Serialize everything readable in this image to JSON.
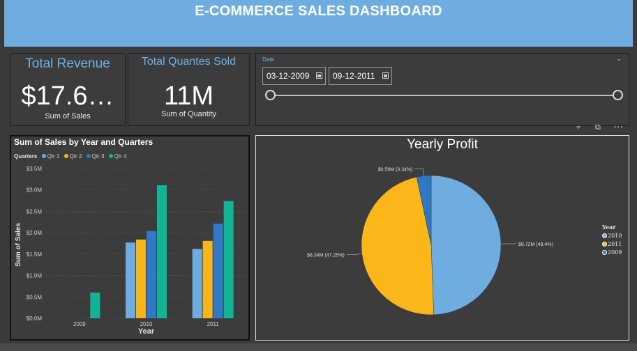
{
  "header": {
    "title": "E-COMMERCE SALES DASHBOARD"
  },
  "kpi_revenue": {
    "title": "Total Revenue",
    "value": "$17.6…",
    "subtitle": "Sum of Sales"
  },
  "kpi_quantity": {
    "title": "Total Quantes Sold",
    "value": "11M",
    "subtitle": "Sum of Quantity"
  },
  "date_slicer": {
    "title": "Date",
    "start": "03-12-2009",
    "end": "09-12-2011",
    "range_start_fraction": 0,
    "range_end_fraction": 1
  },
  "visual_header_icons": [
    "filter-icon",
    "focus-mode-icon",
    "more-options-icon"
  ],
  "colors": {
    "qtr1": "#6fade0",
    "qtr2": "#f5b51b",
    "qtr3": "#2f79c8",
    "qtr4": "#12b496",
    "y2010": "#6fade0",
    "y2011": "#fbb61a",
    "y2009": "#2e77c4",
    "header": "#6fade0"
  },
  "chart_data": [
    {
      "type": "bar",
      "title": "Sum of Sales by Year and Quarters",
      "legend_title": "Quarters",
      "legend_position": "top-left",
      "categories": [
        "2009",
        "2010",
        "2011"
      ],
      "series": [
        {
          "name": "Qtr 1",
          "values": [
            0,
            1.77,
            1.62
          ]
        },
        {
          "name": "Qtr 2",
          "values": [
            0,
            1.84,
            1.81
          ]
        },
        {
          "name": "Qtr 3",
          "values": [
            0,
            2.04,
            2.21
          ]
        },
        {
          "name": "Qtr 4",
          "values": [
            0.6,
            3.11,
            2.74
          ]
        }
      ],
      "xlabel": "Year",
      "ylabel": "Sum of Sales",
      "ylim": [
        0,
        3.5
      ],
      "yticks": [
        "$0.0M",
        "$0.5M",
        "$1.0M",
        "$1.5M",
        "$2.0M",
        "$2.5M",
        "$3.0M",
        "$3.5M"
      ],
      "grid": true
    },
    {
      "type": "pie",
      "title": "Yearly Profit",
      "legend_title": "Year",
      "legend_position": "right",
      "slices": [
        {
          "name": "2010",
          "value": 8.72,
          "label": "$8.72M (49.4%)"
        },
        {
          "name": "2011",
          "value": 8.34,
          "label": "$8.34M (47.25%)"
        },
        {
          "name": "2009",
          "value": 0.59,
          "label": "$0.59M (3.34%)"
        }
      ]
    }
  ]
}
